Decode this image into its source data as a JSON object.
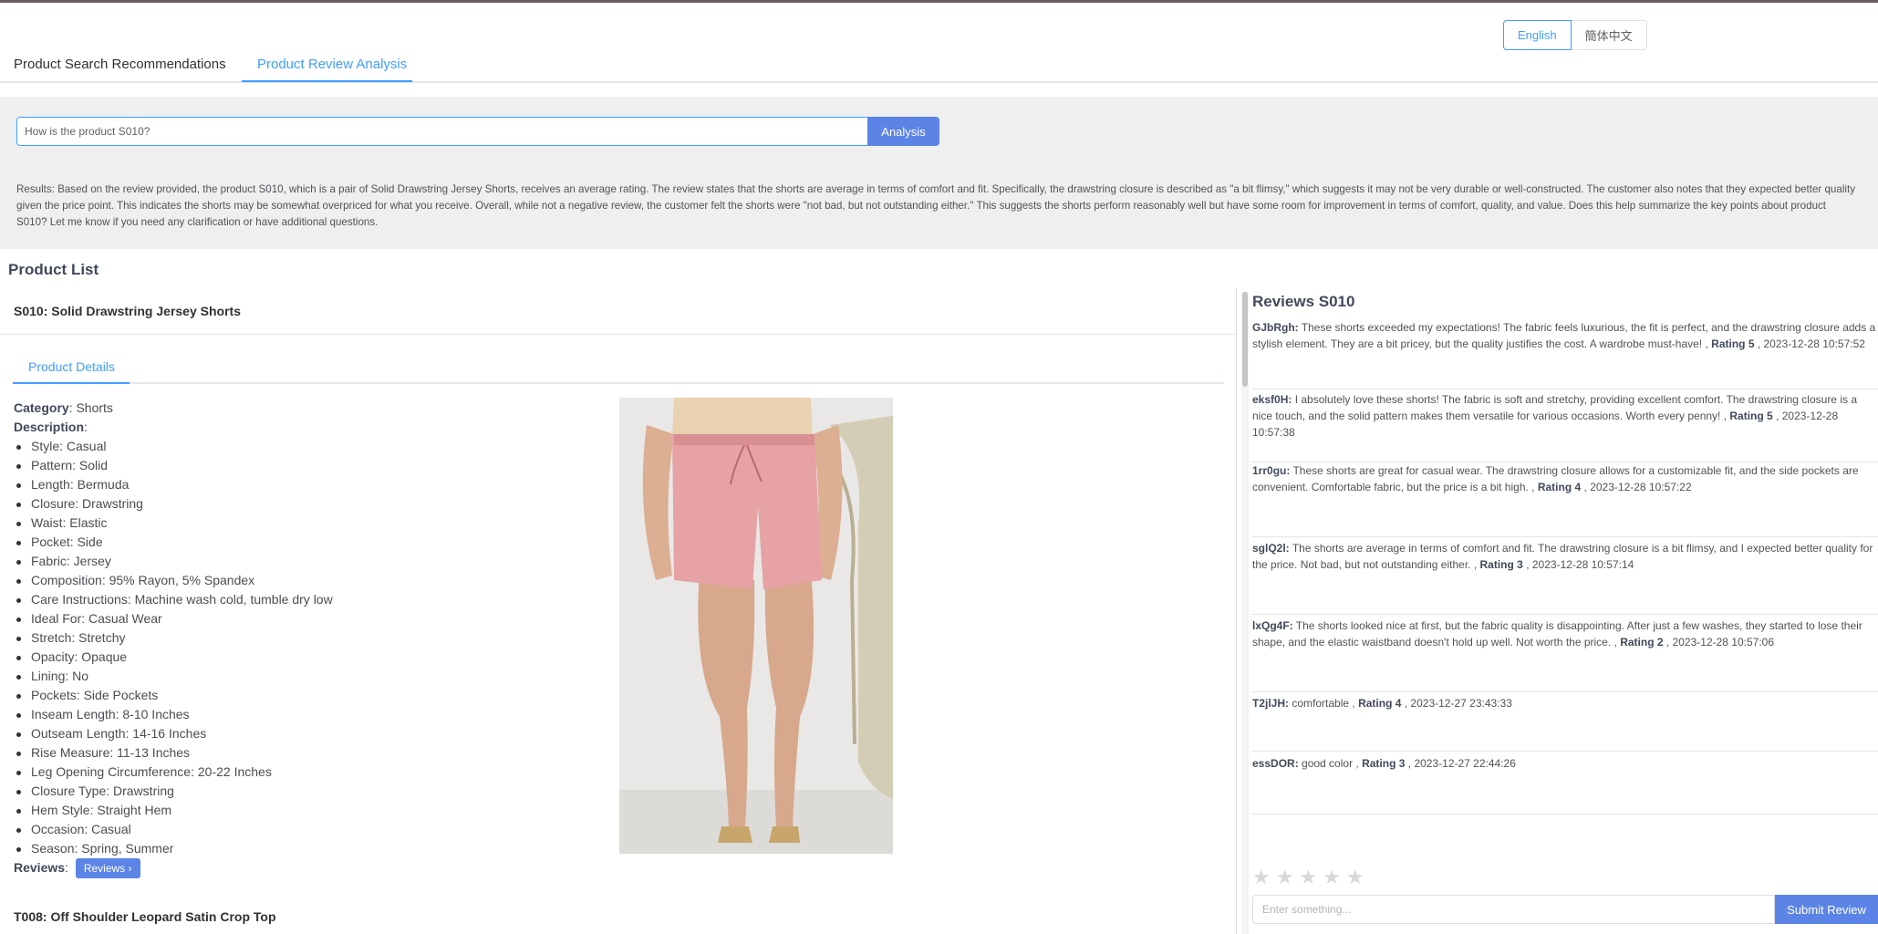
{
  "language": {
    "english": "English",
    "chinese": "簡体中文",
    "selected": "English"
  },
  "tabs": [
    {
      "label": "Product Search Recommendations"
    },
    {
      "label": "Product Review Analysis"
    }
  ],
  "query": {
    "value": "How is the product S010?",
    "analysis_label": "Analysis",
    "results": "Results: Based on the review provided, the product S010, which is a pair of Solid Drawstring Jersey Shorts, receives an average rating. The review states that the shorts are average in terms of comfort and fit. Specifically, the drawstring closure is described as \"a bit flimsy,\" which suggests it may not be very durable or well-constructed. The customer also notes that they expected better quality given the price point. This indicates the shorts may be somewhat overpriced for what you receive. Overall, while not a negative review, the customer felt the shorts were \"not bad, but not outstanding either.\" This suggests the shorts perform reasonably well but have some room for improvement in terms of comfort, quality, and value. Does this help summarize the key points about product S010? Let me know if you need any clarification or have additional questions."
  },
  "product_list": {
    "title": "Product List",
    "product": {
      "heading": "S010: Solid Drawstring Jersey Shorts",
      "details_tab": "Product Details",
      "category_label": "Category",
      "category": "Shorts",
      "description_label": "Description",
      "attributes": [
        "Style: Casual",
        "Pattern: Solid",
        "Length: Bermuda",
        "Closure: Drawstring",
        "Waist: Elastic",
        "Pocket: Side",
        "Fabric: Jersey",
        "Composition: 95% Rayon, 5% Spandex",
        "Care Instructions: Machine wash cold, tumble dry low",
        "Ideal For: Casual Wear",
        "Stretch: Stretchy",
        "Opacity: Opaque",
        "Lining: No",
        "Pockets: Side Pockets",
        "Inseam Length: 8-10 Inches",
        "Outseam Length: 14-16 Inches",
        "Rise Measure: 11-13 Inches",
        "Leg Opening Circumference: 20-22 Inches",
        "Closure Type: Drawstring",
        "Hem Style: Straight Hem",
        "Occasion: Casual",
        "Season: Spring, Summer"
      ],
      "reviews_label": "Reviews",
      "reviews_button": "Reviews"
    },
    "next_product_heading": "T008: Off Shoulder Leopard Satin Crop Top"
  },
  "reviews": {
    "title": "Reviews S010",
    "rating_word": "Rating",
    "items": [
      {
        "user": "GJbRgh:",
        "text": "These shorts exceeded my expectations! The fabric feels luxurious, the fit is perfect, and the drawstring closure adds a stylish element. They are a bit pricey, but the quality justifies the cost. A wardrobe must-have! ,",
        "rating": "Rating 5",
        "date": ", 2023-12-28 10:57:52"
      },
      {
        "user": "eksf0H:",
        "text": "I absolutely love these shorts! The fabric is soft and stretchy, providing excellent comfort. The drawstring closure is a nice touch, and the solid pattern makes them versatile for various occasions. Worth every penny! ,",
        "rating": "Rating 5",
        "date": ", 2023-12-28 10:57:38"
      },
      {
        "user": "1rr0gu:",
        "text": "These shorts are great for casual wear. The drawstring closure allows for a customizable fit, and the side pockets are convenient. Comfortable fabric, but the price is a bit high. ,",
        "rating": "Rating 4",
        "date": ", 2023-12-28 10:57:22"
      },
      {
        "user": "sglQ2l:",
        "text": "The shorts are average in terms of comfort and fit. The drawstring closure is a bit flimsy, and I expected better quality for the price. Not bad, but not outstanding either. ,",
        "rating": "Rating 3",
        "date": ", 2023-12-28 10:57:14"
      },
      {
        "user": "lxQg4F:",
        "text": "The shorts looked nice at first, but the fabric quality is disappointing. After just a few washes, they started to lose their shape, and the elastic waistband doesn't hold up well. Not worth the price. ,",
        "rating": "Rating 2",
        "date": ", 2023-12-28 10:57:06"
      },
      {
        "user": "T2jlJH:",
        "text": "comfortable ,",
        "rating": "Rating 4",
        "date": ", 2023-12-27 23:43:33"
      },
      {
        "user": "essDOR:",
        "text": "good color ,",
        "rating": "Rating 3",
        "date": ", 2023-12-27 22:44:26"
      }
    ],
    "stars": "★★★★★",
    "input_placeholder": "Enter something...",
    "submit_label": "Submit Review"
  },
  "colors": {
    "accent": "#409eff",
    "button": "#5b84e6",
    "panel_bg": "#efefef"
  }
}
